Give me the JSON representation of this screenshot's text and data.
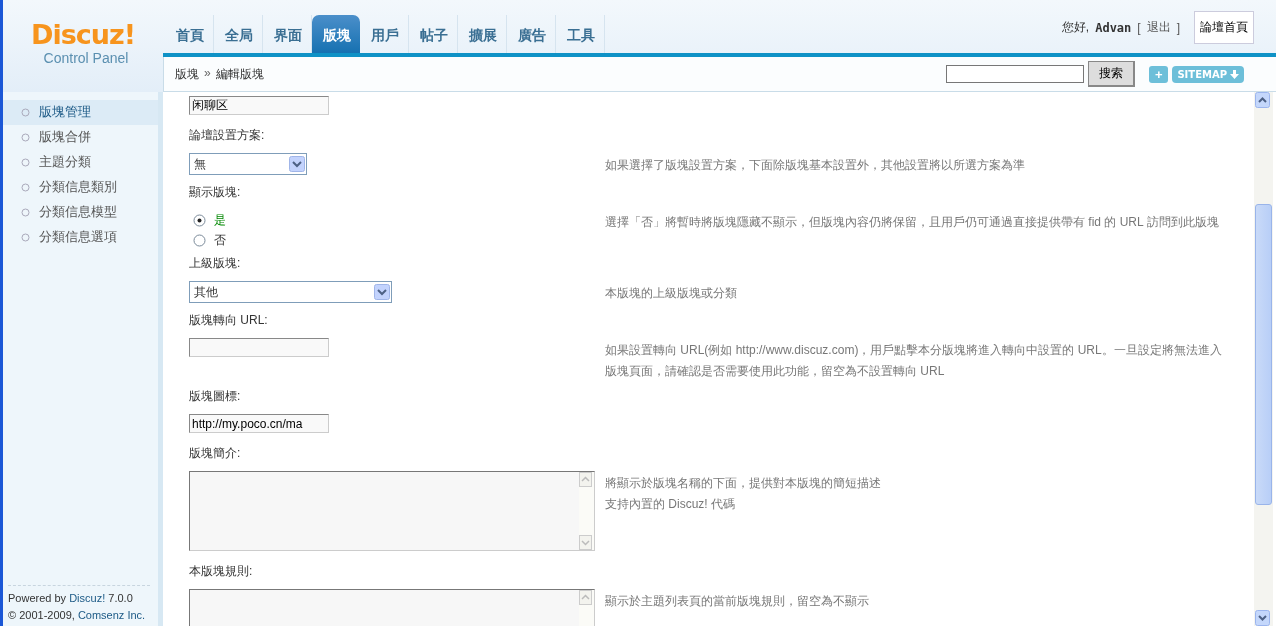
{
  "logo": {
    "name": "Discuz!",
    "subtitle": "Control Panel"
  },
  "nav_tabs": [
    {
      "label": "首頁",
      "selected": false
    },
    {
      "label": "全局",
      "selected": false
    },
    {
      "label": "界面",
      "selected": false
    },
    {
      "label": "版塊",
      "selected": true
    },
    {
      "label": "用戶",
      "selected": false
    },
    {
      "label": "帖子",
      "selected": false
    },
    {
      "label": "擴展",
      "selected": false
    },
    {
      "label": "廣告",
      "selected": false
    },
    {
      "label": "工具",
      "selected": false
    }
  ],
  "user_bar": {
    "greeting": "您好,",
    "username": "Advan",
    "bracket_open": "[",
    "logout": "退出",
    "bracket_close": "]",
    "forum_home": "論壇首頁"
  },
  "breadcrumb": {
    "section": "版塊",
    "separator": "»",
    "current": "編輯版塊"
  },
  "search": {
    "button": "搜索"
  },
  "add_button": "+",
  "sitemap_button": "SITEMAP",
  "sidebar": {
    "items": [
      {
        "label": "版塊管理",
        "selected": true
      },
      {
        "label": "版塊合併",
        "selected": false
      },
      {
        "label": "主題分類",
        "selected": false
      },
      {
        "label": "分類信息類別",
        "selected": false
      },
      {
        "label": "分類信息模型",
        "selected": false
      },
      {
        "label": "分類信息選項",
        "selected": false
      }
    ],
    "footer": {
      "powered_by": "Powered by",
      "product": "Discuz!",
      "version": "7.0.0",
      "copyright": "© 2001-2009,",
      "company": "Comsenz Inc."
    }
  },
  "form": [
    {
      "kind": "text",
      "value": "闲聊区"
    },
    {
      "kind": "select",
      "label": "論壇設置方案:",
      "value": "無",
      "description": [
        "如果選擇了版塊設置方案，下面除版塊基本設置外，其他設置將以所選方案為準"
      ]
    },
    {
      "kind": "radio",
      "label": "顯示版塊:",
      "options": [
        {
          "label": "是",
          "selected": true
        },
        {
          "label": "否",
          "selected": false
        }
      ],
      "description": [
        "選擇「否」將暫時將版塊隱藏不顯示，但版塊內容仍將保留，且用戶仍可通過直接提供帶有 fid 的 URL 訪問到此版塊"
      ]
    },
    {
      "kind": "select_wide",
      "label": "上級版塊:",
      "value": "其他",
      "description": [
        "本版塊的上級版塊或分類"
      ]
    },
    {
      "kind": "text",
      "label": "版塊轉向 URL:",
      "description": [
        "如果設置轉向 URL(例如 http://www.discuz.com)，用戶點擊本分版塊將進入轉向中設置的 URL。一旦設定將無法進入版塊頁面，請確認是否需要使用此功能，留空為不設置轉向 URL"
      ]
    },
    {
      "kind": "text",
      "label": "版塊圖標:",
      "value": "http://my.poco.cn/ma"
    },
    {
      "kind": "textarea",
      "label": "版塊簡介:",
      "description": [
        "將顯示於版塊名稱的下面，提供對本版塊的簡短描述",
        "支持內置的 Discuz! 代碼"
      ]
    },
    {
      "kind": "textarea",
      "label": "本版塊規則:",
      "description": [
        "顯示於主題列表頁的當前版塊規則，留空為不顯示"
      ]
    }
  ]
}
